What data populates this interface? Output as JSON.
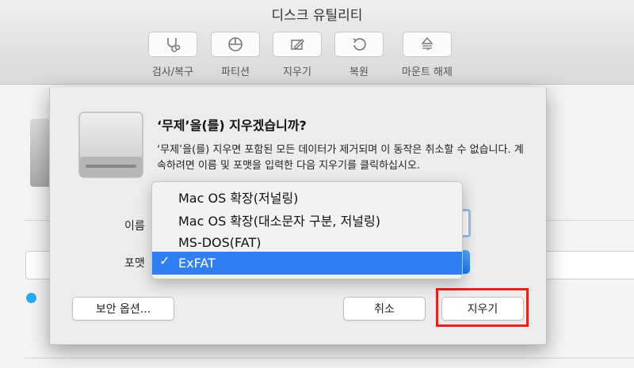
{
  "window": {
    "title": "디스크 유틸리티"
  },
  "toolbar": [
    {
      "label": "검사/복구",
      "icon": "stethoscope-icon"
    },
    {
      "label": "파티션",
      "icon": "pie-chart-icon"
    },
    {
      "label": "지우기",
      "icon": "erase-icon"
    },
    {
      "label": "복원",
      "icon": "restore-icon"
    },
    {
      "label": "마운트 해제",
      "icon": "eject-icon"
    }
  ],
  "dialog": {
    "title": "‘무제’을(를) 지우겠습니까?",
    "message": "‘무제’을(를) 지우면 포함된 모든 데이터가 제거되며 이 동작은 취소할 수 없습니다. 계속하려면 이름 및 포맷을 입력한 다음 지우기를 클릭하십시오.",
    "name_label": "이름",
    "format_label": "포맷",
    "security_button": "보안 옵션...",
    "cancel_button": "취소",
    "erase_button": "지우기"
  },
  "format_menu": {
    "options": [
      "Mac OS 확장(저널링)",
      "Mac OS 확장(대소문자 구분, 저널링)",
      "MS-DOS(FAT)",
      "ExFAT"
    ],
    "selected": "ExFAT",
    "check_glyph": "✓"
  },
  "colors": {
    "selection": "#2f7ff2",
    "highlight_box": "#e2231a",
    "dot": "#2eaaf2"
  }
}
